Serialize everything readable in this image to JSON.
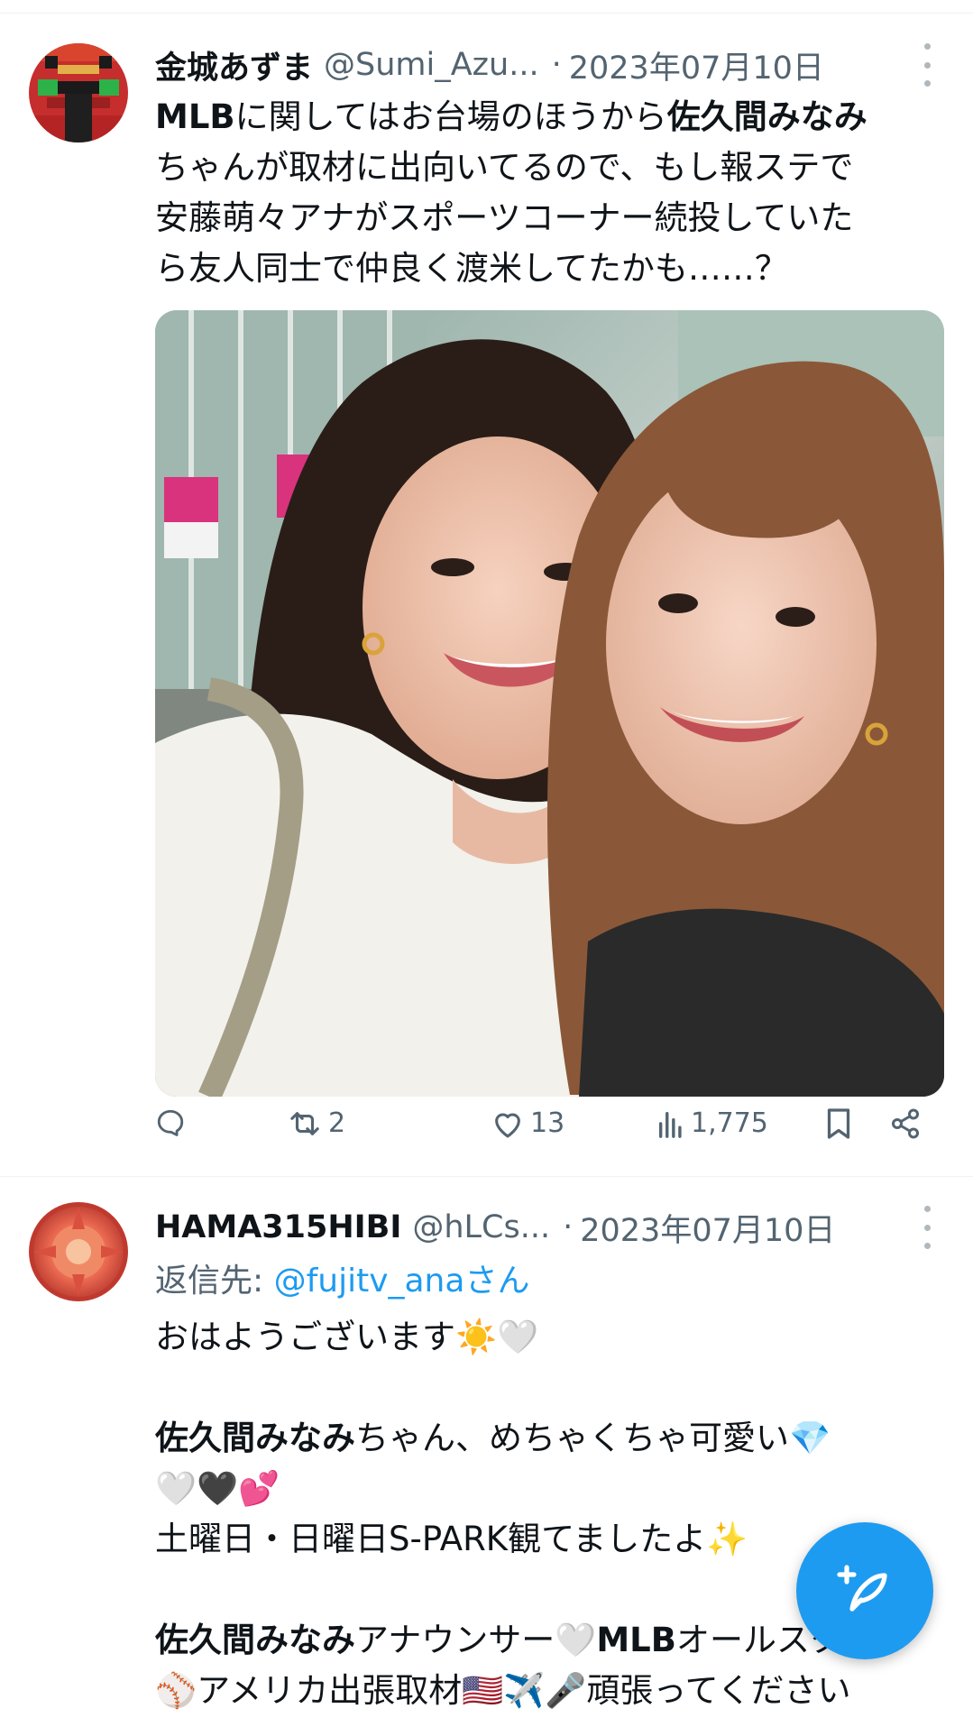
{
  "tweet1": {
    "author_name": "金城あずま",
    "author_handle": "@Sumi_Azu...",
    "separator": "·",
    "date": "2023年07月10日",
    "body": [
      [
        {
          "t": "MLB",
          "b": true
        },
        {
          "t": "に関してはお台場のほうから",
          "b": false
        },
        {
          "t": "佐久間みなみ",
          "b": true
        }
      ],
      [
        {
          "t": "ちゃんが取材に出向いてるので、もし報ステで",
          "b": false
        }
      ],
      [
        {
          "t": "安藤萌々アナがスポーツコーナー続投していた",
          "b": false
        }
      ],
      [
        {
          "t": "ら友人同士で仲良く渡米してたかも……？",
          "b": false
        }
      ]
    ],
    "actions": {
      "reply_count": "",
      "retweet_count": "2",
      "like_count": "13",
      "views_count": "1,775"
    }
  },
  "tweet2": {
    "author_name": "HAMA315HIBI",
    "author_handle": "@hLCs...",
    "separator": "·",
    "date": "2023年07月10日",
    "reply_prefix": "返信先: ",
    "reply_mention": "@fujitv_ana",
    "reply_suffix": "さん",
    "body": [
      [
        {
          "t": "おはようございます☀️🤍",
          "b": false
        }
      ],
      [
        {
          "t": "",
          "b": false
        }
      ],
      [
        {
          "t": "佐久間みなみ",
          "b": true
        },
        {
          "t": "ちゃん、めちゃくちゃ可愛い💎",
          "b": false
        }
      ],
      [
        {
          "t": "🤍🖤💕",
          "b": false
        }
      ],
      [
        {
          "t": "土曜日・日曜日S-PARK観てましたよ✨",
          "b": false
        }
      ],
      [
        {
          "t": "",
          "b": false
        }
      ],
      [
        {
          "t": "佐久間みなみ",
          "b": true
        },
        {
          "t": "アナウンサー🤍",
          "b": false
        },
        {
          "t": "MLB",
          "b": true
        },
        {
          "t": "オールスター",
          "b": false
        }
      ],
      [
        {
          "t": "⚾アメリカ出張取材🇺🇸✈️🎤頑張ってください",
          "b": false
        }
      ]
    ]
  },
  "colors": {
    "text": "#0f1419",
    "secondary": "#536471",
    "accent": "#1d9bf0",
    "divider": "#eff3f4"
  },
  "icons": {
    "reply": "reply-icon",
    "retweet": "retweet-icon",
    "like": "heart-icon",
    "views": "views-icon",
    "bookmark": "bookmark-icon",
    "share": "share-icon",
    "compose": "compose-icon",
    "more": "more-vertical-icon"
  }
}
